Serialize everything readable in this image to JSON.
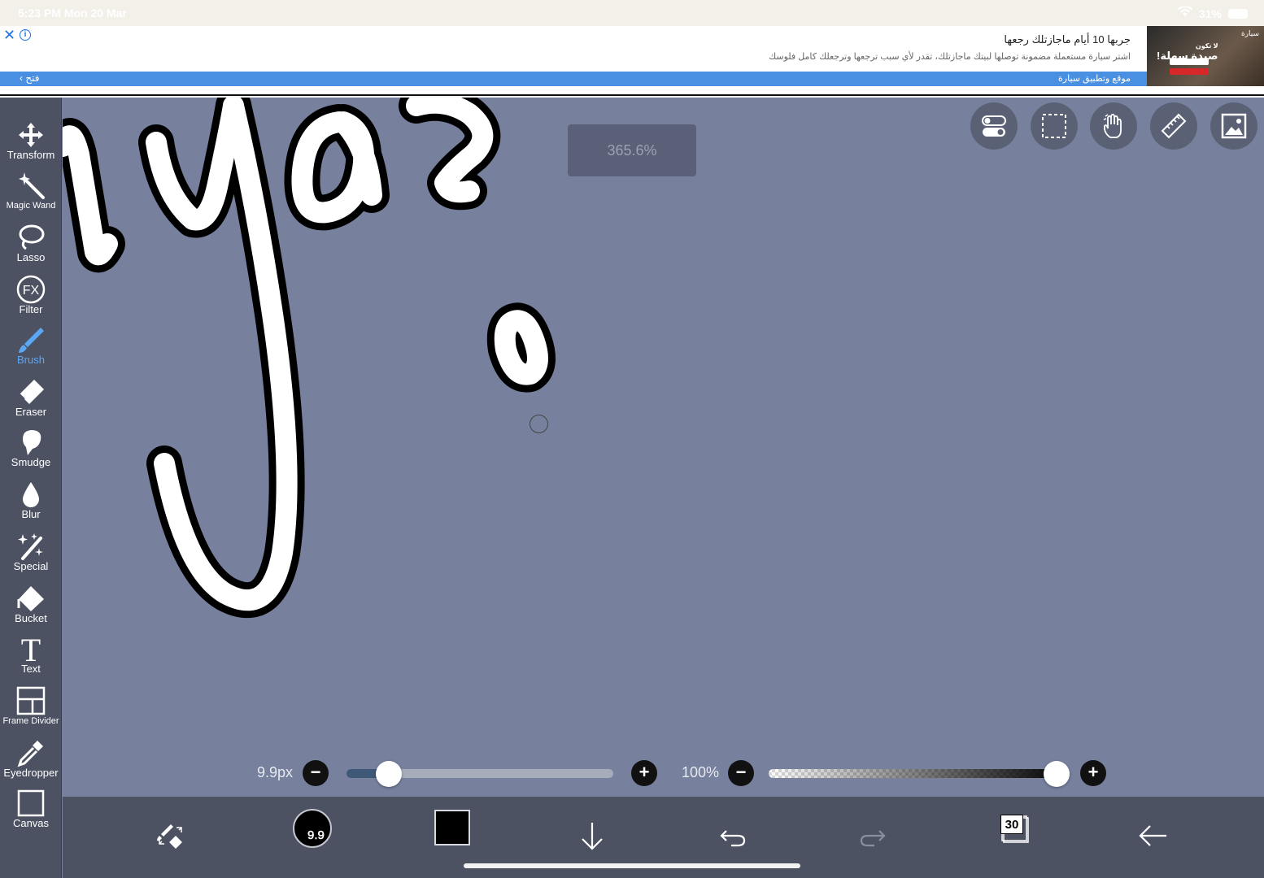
{
  "status_bar": {
    "time": "5:23 PM",
    "date": "Mon 20 Mar",
    "battery": "31%"
  },
  "ad": {
    "title": "جربها 10 أيام ماجازتلك رجعها",
    "description": "اشتر سيارة مستعملة مضمونة توصلها لبيتك ماجازتلك، تقدر لأي سبب ترجعها وترجعلك كامل فلوسك",
    "open_label": "فتح",
    "site_label": "موقع وتطبيق سيارة",
    "image_headline": "صيدة سهلة!",
    "image_kicker": "لا تكون",
    "image_brand": "سيارة"
  },
  "toolbar": {
    "items": [
      {
        "label": "Transform",
        "icon": "move-arrows-icon"
      },
      {
        "label": "Magic Wand",
        "icon": "magic-wand-icon"
      },
      {
        "label": "Lasso",
        "icon": "lasso-icon"
      },
      {
        "label": "Filter",
        "icon": "fx-icon"
      },
      {
        "label": "Brush",
        "icon": "brush-icon",
        "active": true
      },
      {
        "label": "Eraser",
        "icon": "eraser-icon"
      },
      {
        "label": "Smudge",
        "icon": "smudge-icon"
      },
      {
        "label": "Blur",
        "icon": "droplet-icon"
      },
      {
        "label": "Special",
        "icon": "sparkle-wand-icon"
      },
      {
        "label": "Bucket",
        "icon": "bucket-icon"
      },
      {
        "label": "Text",
        "icon": "text-T-icon"
      },
      {
        "label": "Frame Divider",
        "icon": "frame-divider-icon"
      },
      {
        "label": "Eyedropper",
        "icon": "eyedropper-icon"
      },
      {
        "label": "Canvas",
        "icon": "canvas-icon"
      }
    ]
  },
  "canvas": {
    "zoom_label": "365.6%"
  },
  "top_buttons": [
    "toggle-icon",
    "selection-icon",
    "hand-icon",
    "ruler-icon",
    "image-icon"
  ],
  "brush_size": {
    "label": "9.9px",
    "value_fraction": 0.16,
    "preview_label": "9.9"
  },
  "opacity": {
    "label": "100%",
    "value_fraction": 1.0
  },
  "bottom_bar": {
    "layer_count": "30",
    "color": "#000000"
  },
  "colors": {
    "canvas_bg": "#77809d",
    "toolbar_bg": "#4d5263",
    "active_tool": "#5ba7f5",
    "ad_blue": "#4a90e2"
  }
}
